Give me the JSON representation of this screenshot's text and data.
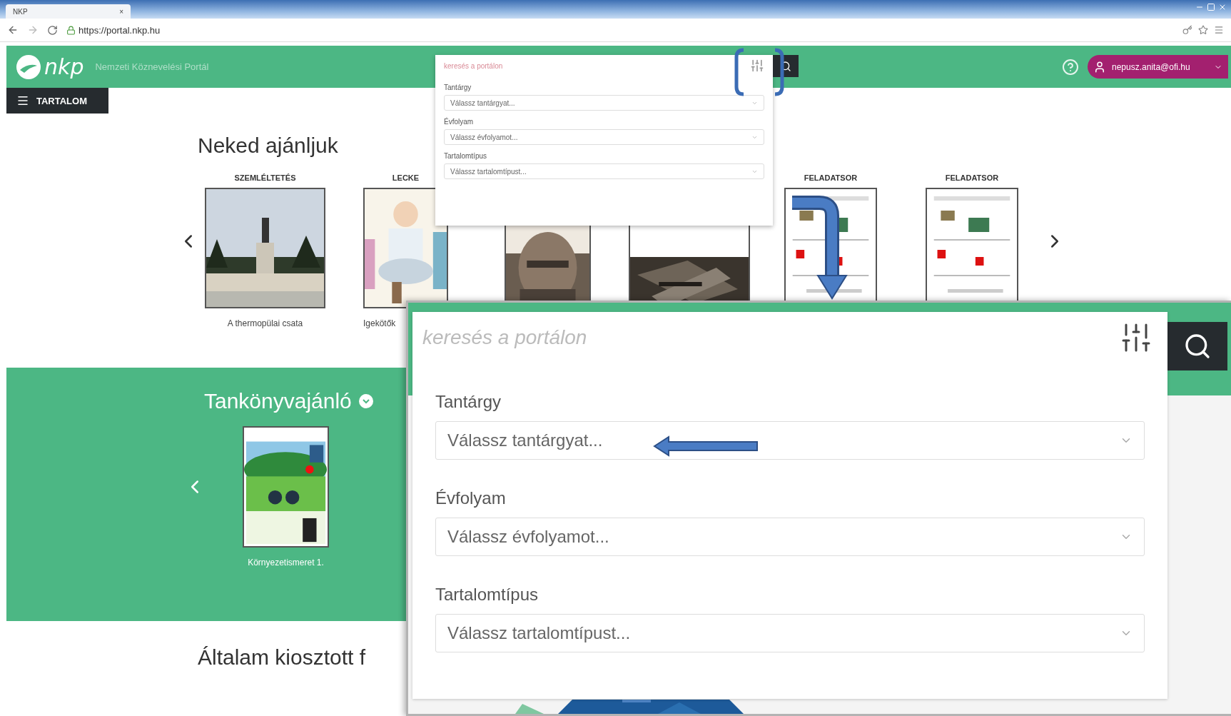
{
  "browser": {
    "tab_title": "NKP",
    "tab_close": "×",
    "url": "https://portal.nkp.hu"
  },
  "header": {
    "logo": "nkp",
    "subtitle": "Nemzeti Köznevelési Portál",
    "user": "nepusz.anita@ofi.hu",
    "menu_button": "TARTALOM"
  },
  "search_popup": {
    "placeholder": "keresés a portálon",
    "filters": [
      {
        "label": "Tantárgy",
        "placeholder": "Válassz tantárgyat..."
      },
      {
        "label": "Évfolyam",
        "placeholder": "Válassz évfolyamot..."
      },
      {
        "label": "Tartalomtípus",
        "placeholder": "Válassz tartalomtípust..."
      }
    ]
  },
  "recommended": {
    "title": "Neked ajánljuk",
    "items": [
      {
        "category": "SZEMLÉLTETÉS",
        "caption": "A thermopülai csata"
      },
      {
        "kind": "illustration",
        "category": "LECKE",
        "caption": "Igekötők"
      },
      {
        "kind": "sepia-photo"
      },
      {
        "kind": "dark-photo"
      },
      {
        "kind": "worksheet",
        "category": "FELADATSOR"
      },
      {
        "kind": "worksheet",
        "category": "FELADATSOR"
      }
    ]
  },
  "textbooks": {
    "title": "Tankönyvajánló",
    "items": [
      {
        "kind": "book",
        "caption": "Környezetismeret 1."
      }
    ]
  },
  "assigned": {
    "title": "Általam kiosztott f"
  },
  "zoomed_popup": {
    "placeholder": "keresés a portálon",
    "filters": [
      {
        "label": "Tantárgy",
        "placeholder": "Válassz tantárgyat..."
      },
      {
        "label": "Évfolyam",
        "placeholder": "Válassz évfolyamot..."
      },
      {
        "label": "Tartalomtípus",
        "placeholder": "Válassz tartalomtípust..."
      }
    ]
  }
}
